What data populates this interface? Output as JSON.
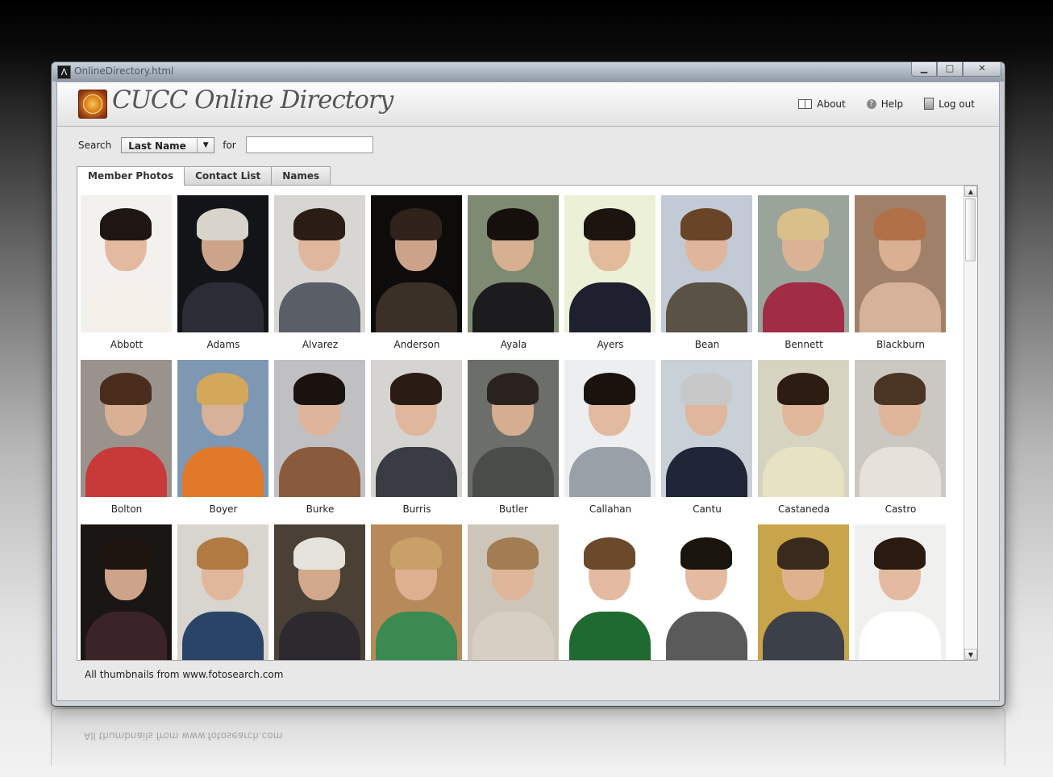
{
  "window": {
    "title": "OnlineDirectory.html",
    "min": "▁",
    "max": "□",
    "close": "✕"
  },
  "header": {
    "brand": "CUCC Online Directory",
    "nav": [
      {
        "label": "About",
        "icon": "book-icon"
      },
      {
        "label": "Help",
        "icon": "help-icon"
      },
      {
        "label": "Log out",
        "icon": "logout-icon"
      }
    ]
  },
  "search": {
    "label": "Search",
    "field": "Last Name",
    "for_label": "for",
    "value": ""
  },
  "tabs": [
    {
      "label": "Member Photos",
      "active": true
    },
    {
      "label": "Contact List",
      "active": false
    },
    {
      "label": "Names",
      "active": false
    }
  ],
  "members": [
    {
      "name": "Abbott",
      "bg": "#f3f1ee",
      "hair": "#1e1612",
      "body": "#f4efe9"
    },
    {
      "name": "Adams",
      "bg": "#121418",
      "hair": "#d8d4cc",
      "body": "#2a2c36"
    },
    {
      "name": "Alvarez",
      "bg": "#d8d6d2",
      "hair": "#2a1d16",
      "body": "#5a5e66"
    },
    {
      "name": "Anderson",
      "bg": "#0e0c0a",
      "hair": "#2e221a",
      "body": "#3a3028"
    },
    {
      "name": "Ayala",
      "bg": "#7e8a72",
      "hair": "#16100c",
      "body": "#1c1c1e"
    },
    {
      "name": "Ayers",
      "bg": "#ecf0d6",
      "hair": "#1c140e",
      "body": "#1e2030"
    },
    {
      "name": "Bean",
      "bg": "#c2cad6",
      "hair": "#6a4426",
      "body": "#5a5244"
    },
    {
      "name": "Bennett",
      "bg": "#9aa49a",
      "hair": "#d9bf8a",
      "body": "#a02c46"
    },
    {
      "name": "Blackburn",
      "bg": "#a08068",
      "hair": "#b27048",
      "body": "#d6b29a"
    },
    {
      "name": "Bolton",
      "bg": "#9a928c",
      "hair": "#4a2c1c",
      "body": "#c83a3a"
    },
    {
      "name": "Boyer",
      "bg": "#7e98b4",
      "hair": "#d4a85a",
      "body": "#e07a2a"
    },
    {
      "name": "Burke",
      "bg": "#c0c0c2",
      "hair": "#1a120e",
      "body": "#8a5a3c"
    },
    {
      "name": "Burris",
      "bg": "#d6d4d0",
      "hair": "#2a1c14",
      "body": "#3a3c44"
    },
    {
      "name": "Butler",
      "bg": "#6c6e6a",
      "hair": "#2a221e",
      "body": "#4a4c48"
    },
    {
      "name": "Callahan",
      "bg": "#eceef0",
      "hair": "#1a120c",
      "body": "#9aa0a8"
    },
    {
      "name": "Cantu",
      "bg": "#c8d0d8",
      "hair": "#c8c8c8",
      "body": "#1e2638"
    },
    {
      "name": "Castaneda",
      "bg": "#d6d4c0",
      "hair": "#2c1c12",
      "body": "#e8e2c4"
    },
    {
      "name": "Castro",
      "bg": "#cac8c0",
      "hair": "#4a3424",
      "body": "#e6e2da"
    },
    {
      "name": "",
      "bg": "#1a1614",
      "hair": "#1e1410",
      "body": "#3a2428"
    },
    {
      "name": "",
      "bg": "#d8d4ce",
      "hair": "#b07a42",
      "body": "#2a4468"
    },
    {
      "name": "",
      "bg": "#4a4036",
      "hair": "#e6e2dc",
      "body": "#2c2a2e"
    },
    {
      "name": "",
      "bg": "#b88a5a",
      "hair": "#c8a068",
      "body": "#3a8a52"
    },
    {
      "name": "",
      "bg": "#cdc6b8",
      "hair": "#a27c52",
      "body": "#d8cfc4"
    },
    {
      "name": "",
      "bg": "#ffffff",
      "hair": "#6a4a2a",
      "body": "#1e6a30"
    },
    {
      "name": "",
      "bg": "#ffffff",
      "hair": "#1a140e",
      "body": "#5a5a5a"
    },
    {
      "name": "",
      "bg": "#c8a44a",
      "hair": "#3a2a1e",
      "body": "#3c4048"
    },
    {
      "name": "",
      "bg": "#f0f0ee",
      "hair": "#2a1a10",
      "body": "#ffffff"
    }
  ],
  "footer": {
    "credit": "All thumbnails from www.fotosearch.com"
  }
}
